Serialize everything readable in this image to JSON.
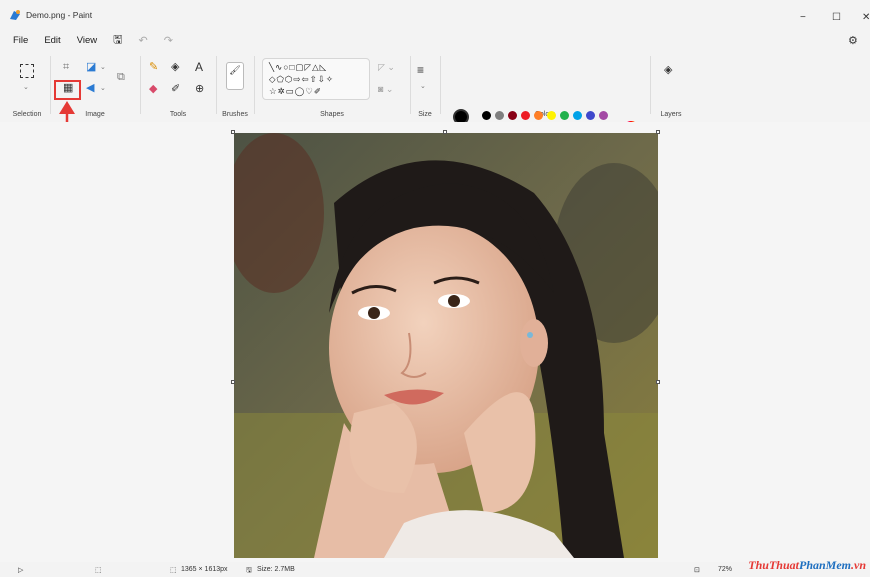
{
  "window": {
    "title": "Demo.png - Paint",
    "minimize": "−",
    "maximize": "☐",
    "close": "✕"
  },
  "menu": [
    "File",
    "Edit",
    "View"
  ],
  "ribbon": {
    "selection": "Selection",
    "image": "Image",
    "tools": "Tools",
    "brushes": "Brushes",
    "shapes": "Shapes",
    "size": "Size",
    "colors": "Colors",
    "layers": "Layers"
  },
  "shapes": {
    "row1": "╲∿○□▢◸△◺",
    "row2": "◇⬠⬡⇨⇦⇧⇩✧",
    "row3": "☆✲▭◯♡✐"
  },
  "colors": {
    "primary": "#000000",
    "secondary": "#ffffff",
    "palette_row1": [
      "#000000",
      "#7f7f7f",
      "#880015",
      "#ed1c24",
      "#ff7f27",
      "#fff200",
      "#22b14c",
      "#00a2e8",
      "#3f48cc",
      "#a349a4"
    ],
    "palette_row2": [
      "#ffffff",
      "#c3c3c3",
      "#b97a57",
      "#ffaec9",
      "#ffc90e",
      "#efe4b0",
      "#b5e61d",
      "#99d9ea",
      "#7092be",
      "#c8bfe7"
    ],
    "highlight": "#e53935"
  },
  "status": {
    "dimensions": "1365 × 1613px",
    "size": "Size: 2.7MB",
    "zoom": "72%"
  },
  "watermark": {
    "part1": "ThuThuat",
    "part2": "PhanMem",
    "part3": ".vn"
  }
}
